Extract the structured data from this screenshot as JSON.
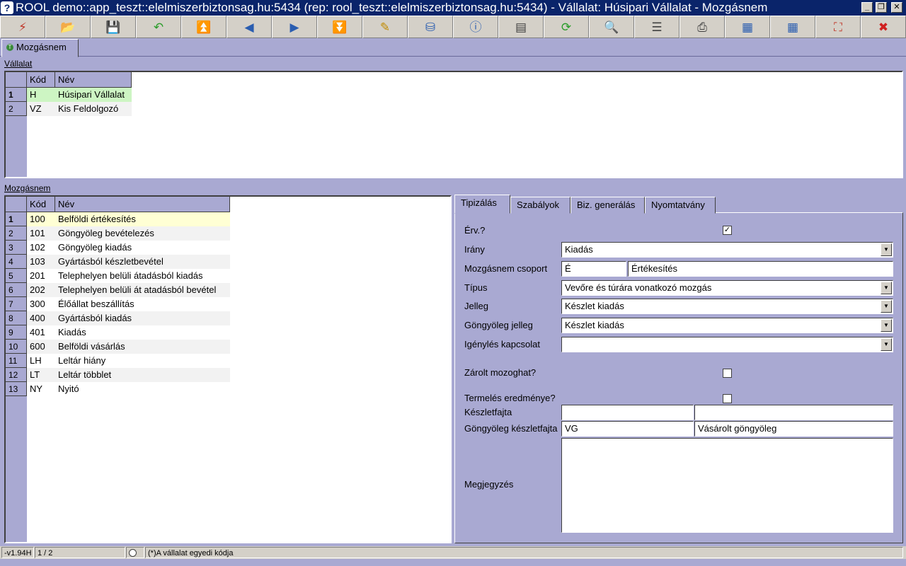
{
  "window": {
    "title": "ROOL demo::app_teszt::elelmiszerbiztonsag.hu:5434 (rep: rool_teszt::elelmiszerbiztonsag.hu:5434) - Vállalat: Húsipari Vállalat - Mozgásnem",
    "minimize": "_",
    "restore": "❐",
    "close": "✕"
  },
  "toolbar": [
    {
      "icon": "lightning-icon",
      "glyph": "⚡",
      "color": "#c0392b"
    },
    {
      "icon": "open-folder-icon",
      "glyph": "📂",
      "color": "#2a5db0"
    },
    {
      "icon": "save-disk-icon",
      "glyph": "💾",
      "color": "#404040"
    },
    {
      "icon": "undo-icon",
      "glyph": "↶",
      "color": "#2a9d2a"
    },
    {
      "icon": "first-record-icon",
      "glyph": "⏫",
      "color": "#2a5db0"
    },
    {
      "icon": "previous-record-icon",
      "glyph": "◀",
      "color": "#2a5db0"
    },
    {
      "icon": "next-record-icon",
      "glyph": "▶",
      "color": "#2a5db0"
    },
    {
      "icon": "last-record-icon",
      "glyph": "⏬",
      "color": "#2a5db0"
    },
    {
      "icon": "edit-icon",
      "glyph": "✎",
      "color": "#c08a00"
    },
    {
      "icon": "database-icon",
      "glyph": "⛁",
      "color": "#2a5db0"
    },
    {
      "icon": "info-icon",
      "glyph": "ⓘ",
      "color": "#2a5db0"
    },
    {
      "icon": "form-view-icon",
      "glyph": "▤",
      "color": "#404040"
    },
    {
      "icon": "refresh-icon",
      "glyph": "⟳",
      "color": "#2a9d2a"
    },
    {
      "icon": "search-icon",
      "glyph": "🔍",
      "color": "#404040"
    },
    {
      "icon": "columns-icon",
      "glyph": "☰",
      "color": "#404040"
    },
    {
      "icon": "print-icon",
      "glyph": "⎙",
      "color": "#404040"
    },
    {
      "icon": "grid-export-icon",
      "glyph": "▦",
      "color": "#2a5db0"
    },
    {
      "icon": "grid-import-icon",
      "glyph": "▦",
      "color": "#2a5db0"
    },
    {
      "icon": "fullscreen-icon",
      "glyph": "⛶",
      "color": "#c0392b"
    },
    {
      "icon": "exit-icon",
      "glyph": "✖",
      "color": "#d02020"
    }
  ],
  "main_tab": {
    "label": "Mozgásnem",
    "icon_glyph": "T"
  },
  "company": {
    "section_label": "Vállalat",
    "columns": [
      "Kód",
      "Név"
    ],
    "rows": [
      {
        "num": "1",
        "kod": "H",
        "nev": "Húsipari Vállalat"
      },
      {
        "num": "2",
        "kod": "VZ",
        "nev": "Kis Feldolgozó"
      }
    ]
  },
  "movement": {
    "section_label": "Mozgásnem",
    "columns": [
      "Kód",
      "Név"
    ],
    "rows": [
      {
        "num": "1",
        "kod": "100",
        "nev": "Belföldi értékesítés"
      },
      {
        "num": "2",
        "kod": "101",
        "nev": "Göngyöleg bevételezés"
      },
      {
        "num": "3",
        "kod": "102",
        "nev": "Göngyöleg  kiadás"
      },
      {
        "num": "4",
        "kod": "103",
        "nev": "Gyártásból készletbevétel"
      },
      {
        "num": "5",
        "kod": "201",
        "nev": "Telephelyen belüli átadásból kiadás"
      },
      {
        "num": "6",
        "kod": "202",
        "nev": "Telephelyen belüli át atadásból bevétel"
      },
      {
        "num": "7",
        "kod": "300",
        "nev": "Élőállat beszállítás"
      },
      {
        "num": "8",
        "kod": "400",
        "nev": "Gyártásból kiadás"
      },
      {
        "num": "9",
        "kod": "401",
        "nev": "Kiadás"
      },
      {
        "num": "10",
        "kod": "600",
        "nev": "Belföldi vásárlás"
      },
      {
        "num": "11",
        "kod": "LH",
        "nev": "Leltár hiány"
      },
      {
        "num": "12",
        "kod": "LT",
        "nev": "Leltár többlet"
      },
      {
        "num": "13",
        "kod": "NY",
        "nev": "Nyitó"
      }
    ]
  },
  "detail_tabs": [
    "Tipizálás",
    "Szabályok",
    "Biz. generálás",
    "Nyomtatvány"
  ],
  "form": {
    "erv_label": "Érv.?",
    "erv_check": "✓",
    "irany_label": "Irány",
    "irany_value": "Kiadás",
    "csoport_label": "Mozgásnem csoport",
    "csoport_code": "É",
    "csoport_name": "Értékesítés",
    "tipus_label": "Típus",
    "tipus_value": "Vevőre és túrára vonatkozó mozgás",
    "jelleg_label": "Jelleg",
    "jelleg_value": "Készlet kiadás",
    "gongy_jelleg_label": "Göngyöleg jelleg",
    "gongy_jelleg_value": "Készlet kiadás",
    "igenyles_label": "Igénylés kapcsolat",
    "igenyles_value": "",
    "zarolt_label": "Zárolt mozoghat?",
    "termeles_label": "Termelés eredménye?",
    "keszletfajta_label": "Készletfajta",
    "keszletfajta_code": "",
    "keszletfajta_name": "",
    "gongy_keszletfajta_label": "Göngyöleg készletfajta",
    "gongy_keszletfajta_code": "VG",
    "gongy_keszletfajta_name": "Vásárolt göngyöleg",
    "megjegyzes_label": "Megjegyzés",
    "megjegyzes_value": ""
  },
  "status": {
    "version": "-v1.94H",
    "position": "1 / 2",
    "hint": "(*)A vállalat egyedi kódja"
  }
}
